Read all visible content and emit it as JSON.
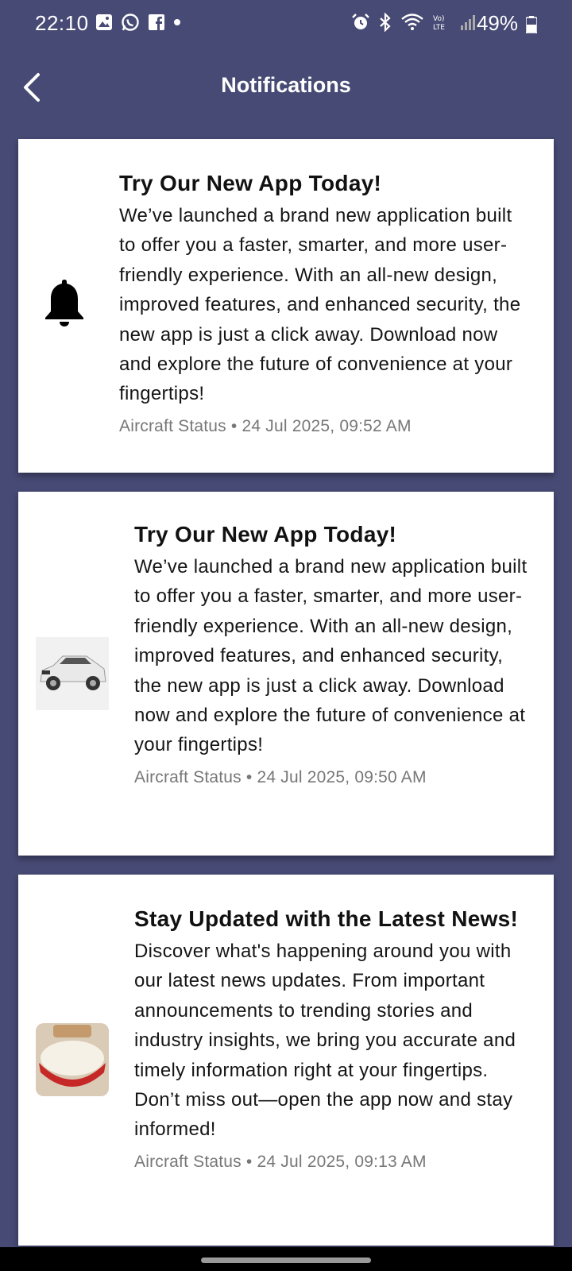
{
  "status_bar": {
    "time": "22:10",
    "battery": "49%",
    "left_icons": [
      "gallery-icon",
      "whatsapp-icon",
      "facebook-icon",
      "dot-icon"
    ],
    "right_icons": [
      "alarm-icon",
      "bluetooth-icon",
      "wifi-icon",
      "volte-icon",
      "signal-icon"
    ]
  },
  "header": {
    "title": "Notifications"
  },
  "notifications": [
    {
      "thumb": "bell-icon",
      "title": "Try Our New App Today!",
      "body": "We’ve launched a brand new application built to offer you a faster, smarter, and more user-friendly experience. With an all-new design, improved features, and enhanced security, the new app is just a click away. Download now and explore the future of convenience at your fingertips!",
      "meta": "Aircraft Status • 24 Jul 2025, 09:52 AM"
    },
    {
      "thumb": "car-image",
      "title": "Try Our New App Today!",
      "body": "We’ve launched a brand new application built to offer you a faster, smarter, and more user-friendly experience. With an all-new design, improved features, and enhanced security, the new app is just a click away. Download now and explore the future of convenience at your fingertips!",
      "meta": "Aircraft Status • 24 Jul 2025, 09:50 AM"
    },
    {
      "thumb": "food-image",
      "title": "Stay Updated with the Latest News!",
      "body": "Discover what's happening around you with our latest news updates. From important announcements to trending stories and industry insights, we bring you accurate and timely information right at your fingertips. Don’t miss out—open the app now and stay informed!",
      "meta": "Aircraft Status • 24 Jul 2025, 09:13 AM"
    }
  ]
}
